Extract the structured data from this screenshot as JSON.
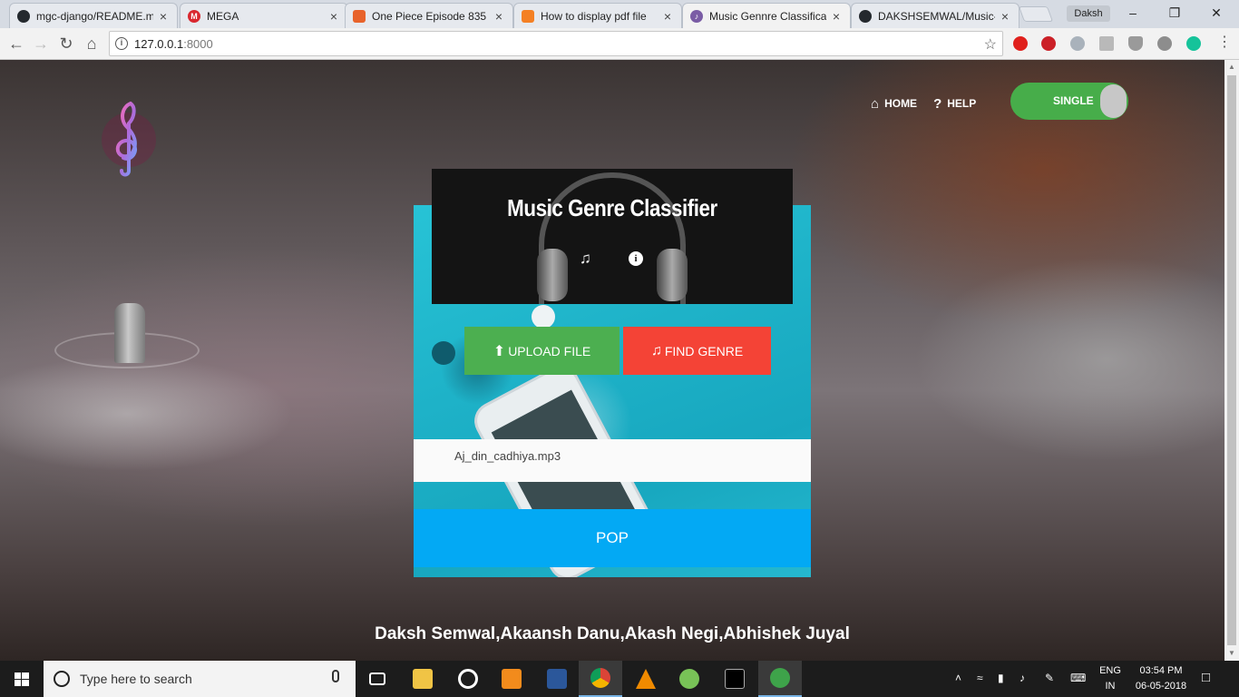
{
  "browser": {
    "tabs": [
      {
        "title": "mgc-django/README.m",
        "active": false,
        "favicon": "github-icon",
        "color": "#24292e"
      },
      {
        "title": "MEGA",
        "active": false,
        "favicon": "mega-icon",
        "color": "#d9272e"
      },
      {
        "title": "One Piece Episode 835",
        "active": false,
        "favicon": "page-icon",
        "color": "#e8632b"
      },
      {
        "title": "How to display pdf file",
        "active": false,
        "favicon": "stackoverflow-icon",
        "color": "#f48024"
      },
      {
        "title": "Music Gennre Classifica",
        "active": true,
        "favicon": "music-icon",
        "color": "#7a5ca5"
      },
      {
        "title": "DAKSHSEMWAL/Music-",
        "active": false,
        "favicon": "github-icon",
        "color": "#24292e"
      }
    ],
    "profile": "Daksh",
    "url_host": "127.0.0.1",
    "url_port": ":8000"
  },
  "page": {
    "nav": {
      "home": "HOME",
      "help": "HELP"
    },
    "toggle_label": "SINGLE",
    "title": "Music Genre Classifier",
    "upload_label": "UPLOAD FILE",
    "find_label": "FIND GENRE",
    "file_name": "Aj_din_cadhiya.mp3",
    "result": "POP",
    "authors": "Daksh Semwal,Akaansh Danu,Akash Negi,Abhishek Juyal",
    "colors": {
      "upload": "#4caf50",
      "find": "#f44336",
      "result": "#03a9f4",
      "toggle": "#47ad4a"
    }
  },
  "taskbar": {
    "search_placeholder": "Type here to search",
    "lang_line1": "ENG",
    "lang_line2": "IN",
    "time": "03:54 PM",
    "date": "06-05-2018"
  }
}
